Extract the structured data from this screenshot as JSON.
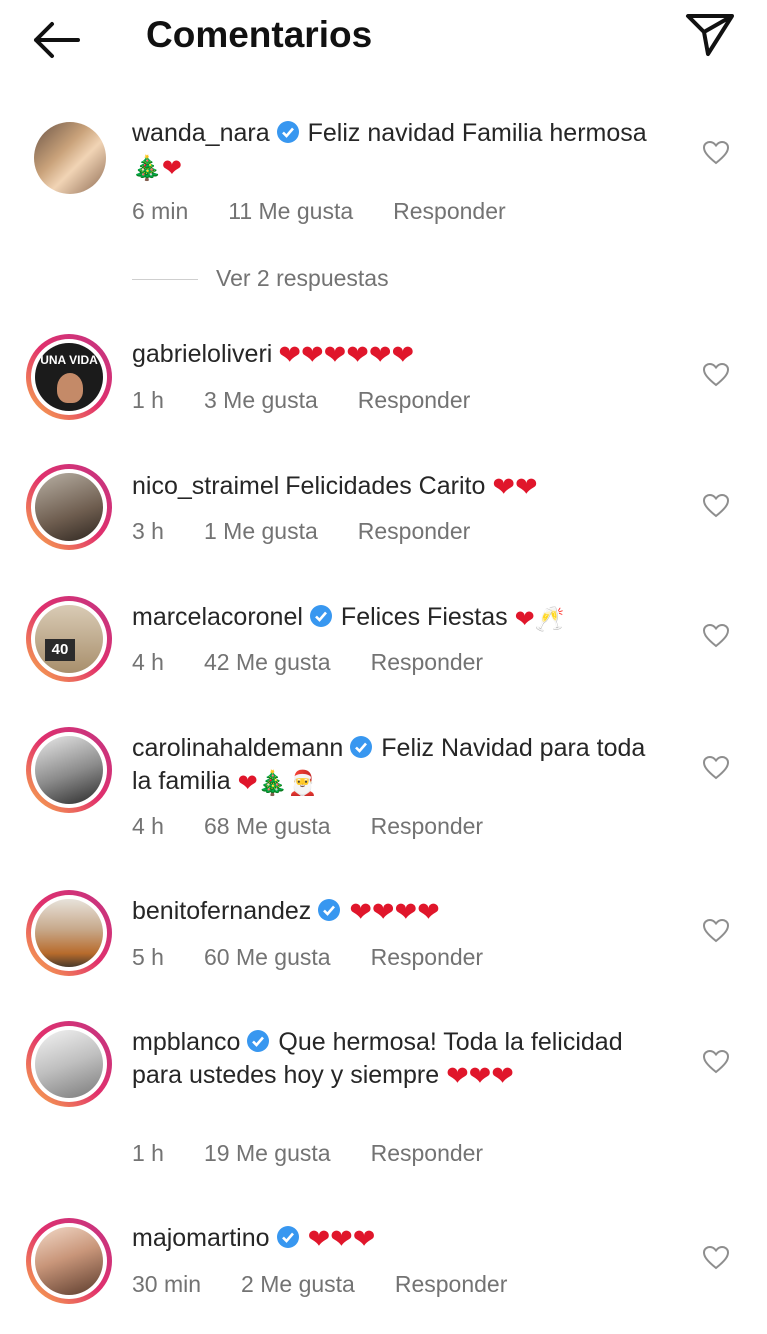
{
  "header": {
    "title": "Comentarios"
  },
  "comments": [
    {
      "user": "wanda_nara",
      "verified": true,
      "text": "Feliz navidad Familia hermosa",
      "emoji": "🎄❤",
      "time": "6 min",
      "likes": "11 Me gusta",
      "reply": "Responder",
      "view_replies": "Ver 2 respuestas"
    },
    {
      "user": "gabrieloliveri",
      "verified": false,
      "text": "",
      "emoji": "❤❤❤❤❤❤",
      "time": "1 h",
      "likes": "3 Me gusta",
      "reply": "Responder",
      "avatar_text": "UNA VIDA"
    },
    {
      "user": "nico_straimel",
      "verified": false,
      "text": "Felicidades Carito",
      "emoji": "❤❤",
      "time": "3 h",
      "likes": "1 Me gusta",
      "reply": "Responder"
    },
    {
      "user": "marcelacoronel",
      "verified": true,
      "text": "Felices Fiestas",
      "emoji": "❤🥂",
      "time": "4 h",
      "likes": "42 Me gusta",
      "reply": "Responder",
      "avatar_text": "40"
    },
    {
      "user": "carolinahaldemann",
      "verified": true,
      "text": "Feliz Navidad para toda la familia",
      "emoji": "❤🎄🎅",
      "time": "4 h",
      "likes": "68 Me gusta",
      "reply": "Responder"
    },
    {
      "user": "benitofernandez",
      "verified": true,
      "text": "",
      "emoji": "❤❤❤❤",
      "time": "5 h",
      "likes": "60 Me gusta",
      "reply": "Responder"
    },
    {
      "user": "mpblanco",
      "verified": true,
      "text": "Que hermosa! Toda la felicidad para ustedes hoy y siempre",
      "emoji": "❤❤❤",
      "time": "1 h",
      "likes": "19 Me gusta",
      "reply": "Responder"
    },
    {
      "user": "majomartino",
      "verified": true,
      "text": "",
      "emoji": "❤❤❤",
      "time": "30 min",
      "likes": "2 Me gusta",
      "reply": "Responder"
    }
  ],
  "colors": {
    "verified": "#3897f0",
    "heart": "#e0162b",
    "meta": "#737373"
  }
}
